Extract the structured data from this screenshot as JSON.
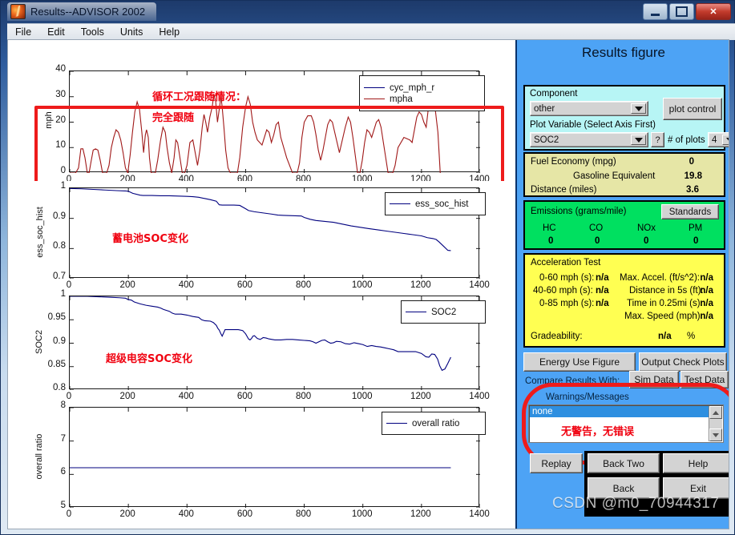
{
  "window": {
    "title": "Results--ADVISOR 2002",
    "icon": "matlab-icon",
    "buttons": {
      "minimize": "minimize-icon",
      "maximize": "maximize-icon",
      "close": "✕"
    }
  },
  "menu": {
    "items": [
      "File",
      "Edit",
      "Tools",
      "Units",
      "Help"
    ]
  },
  "panel": {
    "title": "Results figure",
    "component": {
      "label": "Component",
      "value": "other",
      "plot_control_label": "plot control"
    },
    "plot_variable": {
      "label": "Plot Variable (Select Axis First)",
      "value": "SOC2",
      "help_label": "?",
      "num_plots_label": "# of plots",
      "num_plots_value": "4"
    },
    "fuel": {
      "economy_label": "Fuel Economy (mpg)",
      "economy_value": "0",
      "gasoline_label": "Gasoline Equivalent",
      "gasoline_value": "19.8",
      "distance_label": "Distance (miles)",
      "distance_value": "3.6"
    },
    "emissions": {
      "title": "Emissions (grams/mile)",
      "standards_label": "Standards",
      "columns": [
        "HC",
        "CO",
        "NOx",
        "PM"
      ],
      "values": [
        "0",
        "0",
        "0",
        "0"
      ]
    },
    "acceleration": {
      "title": "Acceleration Test",
      "rows_left": [
        {
          "label": "0-60 mph (s):",
          "value": "n/a"
        },
        {
          "label": "40-60 mph (s):",
          "value": "n/a"
        },
        {
          "label": "0-85 mph (s):",
          "value": "n/a"
        }
      ],
      "rows_right": [
        {
          "label": "Max. Accel. (ft/s^2):",
          "value": "n/a"
        },
        {
          "label": "Distance in 5s (ft):",
          "value": "n/a"
        },
        {
          "label": "Time in 0.25mi (s):",
          "value": "n/a"
        },
        {
          "label": "Max. Speed (mph):",
          "value": "n/a"
        }
      ],
      "gradeability_label": "Gradeability:",
      "gradeability_value": "n/a",
      "gradeability_unit": "%"
    },
    "actions": {
      "energy_use": "Energy Use Figure",
      "output_check": "Output Check Plots",
      "compare_label": "Compare Results With:",
      "sim_data": "Sim Data",
      "test_data": "Test Data",
      "replay": "Replay",
      "back_two": "Back Two",
      "help": "Help",
      "back": "Back",
      "exit": "Exit"
    },
    "warnings": {
      "title": "Warnings/Messages",
      "selected": "none",
      "annotation": "无警告，无错误"
    }
  },
  "watermark": "CSDN @m0_70944317",
  "chart_data": [
    {
      "type": "line",
      "title": "",
      "ylabel": "mph",
      "xlabel": "",
      "xlim": [
        0,
        1400
      ],
      "ylim": [
        0,
        40
      ],
      "xticks": [
        0,
        200,
        400,
        600,
        800,
        1000,
        1200,
        1400
      ],
      "yticks": [
        0,
        10,
        20,
        30,
        40
      ],
      "grid": false,
      "legend_position": "top-right",
      "annotations": [
        "循环工况跟随情况：",
        "完全跟随"
      ],
      "series": [
        {
          "name": "cyc_mph_r",
          "color": "#00007f",
          "values": []
        },
        {
          "name": "mpha",
          "color": "#a01818",
          "x": [
            0,
            20,
            30,
            38,
            45,
            52,
            60,
            66,
            72,
            80,
            88,
            96,
            104,
            112,
            126,
            134,
            142,
            150,
            158,
            166,
            174,
            182,
            190,
            198,
            206,
            214,
            222,
            230,
            238,
            246,
            252,
            258,
            262,
            268,
            272,
            278,
            284,
            292,
            300,
            310,
            318,
            326,
            332,
            340,
            348,
            356,
            362,
            368,
            376,
            384,
            392,
            400,
            410,
            420,
            428,
            436,
            444,
            452,
            458,
            464,
            470,
            478,
            486,
            492,
            498,
            504,
            510,
            516,
            520,
            526,
            532,
            540,
            548,
            556,
            564,
            572,
            580,
            590,
            600,
            608,
            616,
            624,
            632,
            640,
            648,
            656,
            664,
            672,
            680,
            688,
            696,
            704,
            712,
            720,
            740,
            760,
            776,
            784,
            792,
            800,
            812,
            824,
            832,
            840,
            848,
            856,
            864,
            872,
            880,
            888,
            896,
            904,
            912,
            920,
            930,
            940,
            950,
            958,
            966,
            974,
            982,
            990,
            998,
            1006,
            1014,
            1022,
            1030,
            1038,
            1046,
            1054,
            1062,
            1070,
            1078,
            1086,
            1094,
            1102,
            1110,
            1120,
            1140,
            1160,
            1168,
            1176,
            1184,
            1192,
            1200,
            1208,
            1216,
            1224,
            1232,
            1240,
            1248,
            1256,
            1264,
            1272,
            1280,
            1290,
            1300
          ],
          "y": [
            0,
            0,
            2,
            9.5,
            9.5,
            6,
            0,
            0,
            4,
            9,
            9.5,
            9,
            5,
            0,
            0,
            3,
            10,
            14,
            17,
            16,
            13,
            8,
            2,
            0,
            7,
            16,
            24,
            28,
            25,
            16,
            8,
            15,
            17,
            14,
            6,
            0,
            0,
            0,
            5,
            13,
            18,
            16,
            10,
            4,
            0,
            6,
            13,
            12,
            6,
            0,
            0,
            3,
            12,
            13,
            8,
            3,
            9,
            18,
            23,
            20,
            16,
            22,
            26,
            31,
            28,
            20,
            25,
            30,
            26,
            18,
            9,
            2,
            0,
            0,
            0,
            0,
            6,
            18,
            26,
            30,
            27,
            20,
            16,
            13,
            12,
            11,
            14,
            17,
            16,
            12,
            15,
            19,
            20,
            14,
            6,
            0,
            0,
            4,
            14,
            20,
            22.5,
            22.5,
            20,
            15,
            9,
            5,
            9,
            14,
            19,
            21,
            20,
            16,
            12,
            8,
            13,
            18,
            22,
            20,
            14,
            7,
            0,
            0,
            5,
            12,
            17,
            16,
            14,
            17,
            20,
            21,
            18,
            12,
            6,
            0,
            0,
            0,
            3,
            10,
            14,
            13,
            12,
            17,
            22,
            24,
            23,
            20,
            18,
            26,
            30,
            28,
            24,
            16,
            0
          ]
        }
      ]
    },
    {
      "type": "line",
      "ylabel": "ess_soc_hist",
      "xlim": [
        0,
        1400
      ],
      "ylim": [
        0.7,
        1.0
      ],
      "xticks": [
        0,
        200,
        400,
        600,
        800,
        1000,
        1200,
        1400
      ],
      "yticks": [
        0.7,
        0.8,
        0.9,
        1
      ],
      "ytick_labels": [
        "0.7",
        "0.8",
        "0.9",
        "1"
      ],
      "grid": false,
      "legend_position": "top-right",
      "annotations": [
        "蓄电池SOC变化"
      ],
      "series": [
        {
          "name": "ess_soc_hist",
          "color": "#00007f",
          "x": [
            0,
            40,
            80,
            120,
            160,
            190,
            200,
            215,
            240,
            250,
            280,
            310,
            340,
            370,
            400,
            420,
            440,
            460,
            480,
            500,
            510,
            520,
            540,
            560,
            580,
            600,
            610,
            630,
            660,
            690,
            710,
            730,
            760,
            790,
            800,
            820,
            840,
            860,
            880,
            900,
            920,
            940,
            960,
            980,
            1000,
            1020,
            1050,
            1080,
            1110,
            1140,
            1170,
            1200,
            1220,
            1240,
            1250,
            1260,
            1275,
            1290,
            1300
          ],
          "y": [
            0.999,
            0.998,
            0.996,
            0.994,
            0.992,
            0.991,
            0.99,
            0.983,
            0.977,
            0.976,
            0.976,
            0.975,
            0.975,
            0.974,
            0.973,
            0.972,
            0.97,
            0.966,
            0.962,
            0.957,
            0.945,
            0.944,
            0.944,
            0.944,
            0.943,
            0.932,
            0.926,
            0.922,
            0.918,
            0.914,
            0.911,
            0.91,
            0.909,
            0.908,
            0.903,
            0.897,
            0.893,
            0.891,
            0.889,
            0.887,
            0.883,
            0.879,
            0.875,
            0.872,
            0.869,
            0.866,
            0.862,
            0.858,
            0.854,
            0.85,
            0.846,
            0.842,
            0.836,
            0.833,
            0.83,
            0.822,
            0.808,
            0.794,
            0.793
          ]
        }
      ]
    },
    {
      "type": "line",
      "ylabel": "SOC2",
      "xlim": [
        0,
        1400
      ],
      "ylim": [
        0.8,
        1.0
      ],
      "xticks": [
        0,
        200,
        400,
        600,
        800,
        1000,
        1200,
        1400
      ],
      "yticks": [
        0.8,
        0.85,
        0.9,
        0.95,
        1
      ],
      "ytick_labels": [
        "0.8",
        "0.85",
        "0.9",
        "0.95",
        "1"
      ],
      "grid": false,
      "legend_position": "top-right",
      "annotations": [
        "超级电容SOC变化"
      ],
      "series": [
        {
          "name": "SOC2",
          "color": "#00007f",
          "x": [
            0,
            60,
            100,
            140,
            170,
            190,
            200,
            210,
            220,
            240,
            260,
            280,
            300,
            310,
            320,
            340,
            350,
            360,
            380,
            400,
            420,
            440,
            450,
            460,
            480,
            490,
            500,
            505,
            510,
            515,
            520,
            525,
            530,
            545,
            560,
            575,
            590,
            600,
            610,
            615,
            620,
            625,
            630,
            640,
            650,
            660,
            670,
            680,
            700,
            720,
            740,
            760,
            780,
            800,
            820,
            830,
            840,
            850,
            860,
            870,
            880,
            890,
            900,
            910,
            925,
            940,
            955,
            970,
            985,
            1000,
            1015,
            1030,
            1045,
            1060,
            1075,
            1090,
            1105,
            1120,
            1140,
            1160,
            1180,
            1200,
            1215,
            1225,
            1235,
            1245,
            1255,
            1262,
            1270,
            1280,
            1290,
            1300
          ],
          "y": [
            1.0,
            1.0,
            0.999,
            0.998,
            0.997,
            0.996,
            0.993,
            0.992,
            0.988,
            0.984,
            0.981,
            0.979,
            0.977,
            0.975,
            0.972,
            0.968,
            0.964,
            0.962,
            0.962,
            0.96,
            0.957,
            0.955,
            0.95,
            0.948,
            0.947,
            0.944,
            0.938,
            0.932,
            0.928,
            0.921,
            0.915,
            0.922,
            0.929,
            0.929,
            0.929,
            0.929,
            0.927,
            0.92,
            0.909,
            0.907,
            0.91,
            0.915,
            0.916,
            0.91,
            0.908,
            0.912,
            0.911,
            0.909,
            0.907,
            0.907,
            0.908,
            0.908,
            0.907,
            0.906,
            0.905,
            0.903,
            0.9,
            0.903,
            0.906,
            0.907,
            0.903,
            0.9,
            0.901,
            0.904,
            0.903,
            0.899,
            0.898,
            0.901,
            0.899,
            0.897,
            0.893,
            0.895,
            0.893,
            0.892,
            0.89,
            0.888,
            0.886,
            0.882,
            0.882,
            0.882,
            0.882,
            0.878,
            0.871,
            0.87,
            0.877,
            0.876,
            0.866,
            0.852,
            0.842,
            0.845,
            0.857,
            0.87,
            0.88
          ]
        }
      ]
    },
    {
      "type": "line",
      "ylabel": "overall ratio",
      "xlim": [
        0,
        1400
      ],
      "ylim": [
        5,
        8
      ],
      "xticks": [
        0,
        200,
        400,
        600,
        800,
        1000,
        1200,
        1400
      ],
      "yticks": [
        5,
        6,
        7,
        8
      ],
      "grid": false,
      "legend_position": "top-right",
      "annotations": [],
      "series": [
        {
          "name": "overall ratio",
          "color": "#00007f",
          "x": [
            0,
            1300
          ],
          "y": [
            6.2,
            6.2
          ]
        }
      ]
    }
  ]
}
